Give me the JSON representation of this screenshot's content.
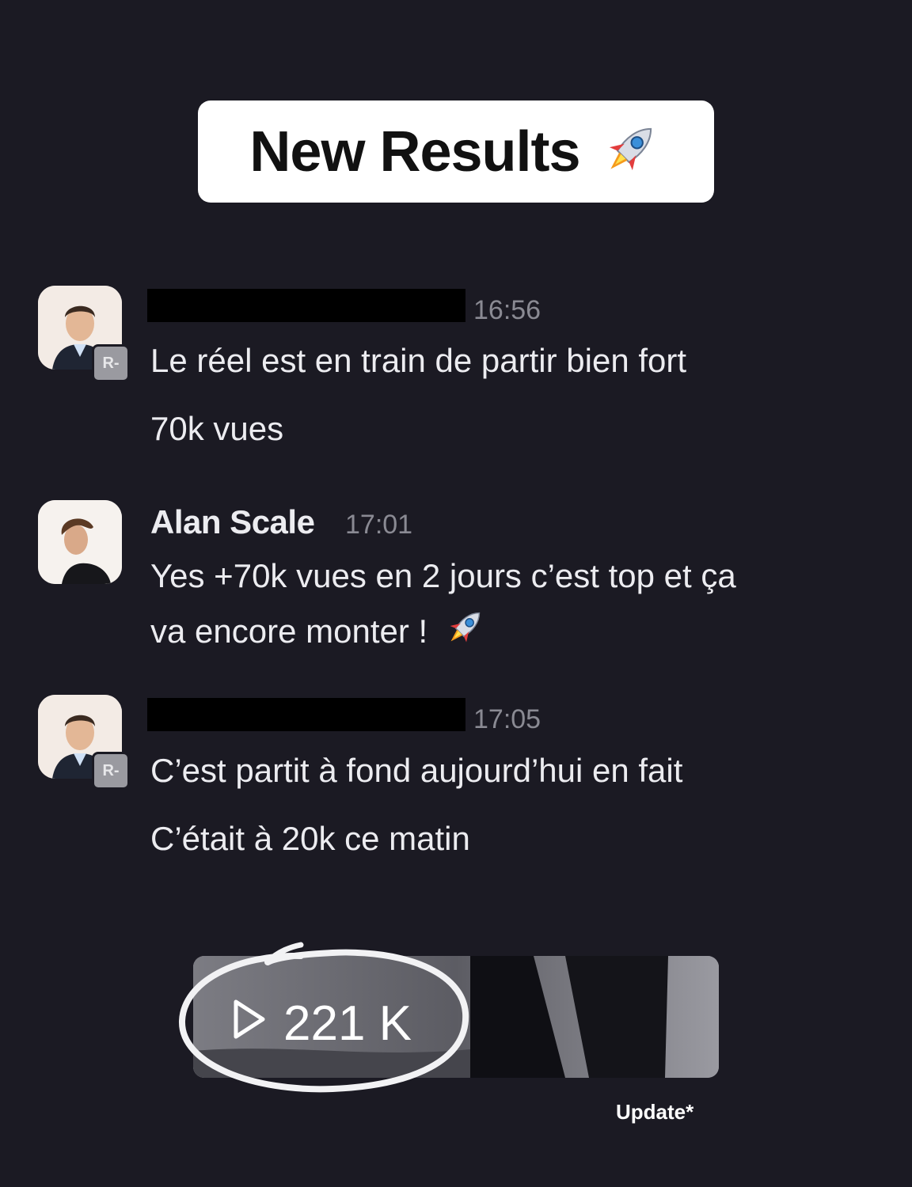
{
  "header": {
    "title": "New Results",
    "icon": "rocket-icon"
  },
  "messages": [
    {
      "author": "",
      "author_redacted": true,
      "time": "16:56",
      "badge": "R-",
      "lines": [
        "Le réel est en train de partir bien fort",
        "70k vues"
      ]
    },
    {
      "author": "Alan Scale",
      "author_redacted": false,
      "time": "17:01",
      "badge": "",
      "lines": [
        "Yes +70k vues en 2 jours c’est top et ça",
        "va encore monter !"
      ]
    },
    {
      "author": "",
      "author_redacted": true,
      "time": "17:05",
      "badge": "R-",
      "lines": [
        "C’est partit à fond aujourd’hui en fait",
        "C’était à 20k ce matin"
      ]
    }
  ],
  "video": {
    "views": "221 K",
    "icon": "play-icon"
  },
  "footer": {
    "note": "Update*"
  },
  "colors": {
    "background": "#1b1a23",
    "text": "#ececf0",
    "muted": "#8a8a93",
    "circle": "#ffffff"
  }
}
